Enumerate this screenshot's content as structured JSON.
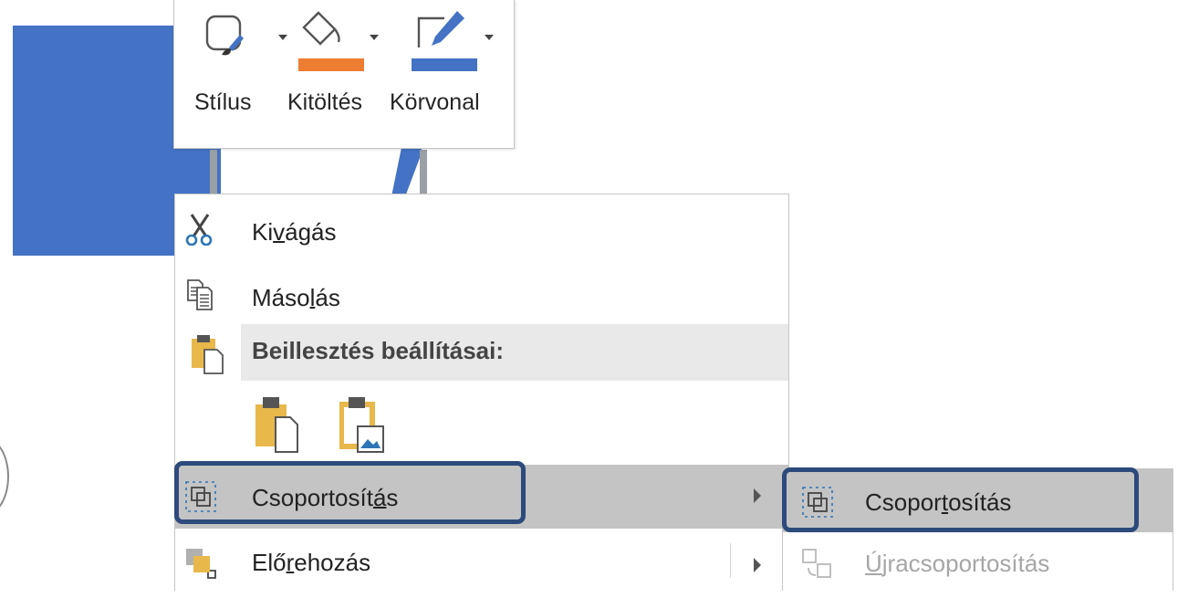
{
  "mini_toolbar": {
    "style_label": "Stílus",
    "fill_label": "Kitöltés",
    "outline_label": "Körvonal",
    "fill_color": "#ed7d31",
    "outline_color": "#4472c4"
  },
  "context_menu": {
    "cut": {
      "before": "Ki",
      "key": "v",
      "after": "ágás"
    },
    "copy": {
      "before": "Máso",
      "key": "l",
      "after": "ás"
    },
    "paste_options_header": "Beillesztés beállításai:",
    "group": {
      "before": "Csoportosít",
      "key": "á",
      "after": "s"
    },
    "bring_forward": {
      "before": "Elő",
      "key": "r",
      "after": "ehozás"
    }
  },
  "submenu": {
    "group": {
      "before": "Csopor",
      "key": "t",
      "after": "osítás"
    },
    "regroup": {
      "before": "",
      "key": "Ú",
      "after": "jracsoportosítás"
    }
  },
  "colors": {
    "slide_shape": "#4472c4",
    "highlight_border": "#2d4a7c",
    "menu_hover": "#c4c4c4",
    "disabled_text": "#a6a6a6"
  }
}
